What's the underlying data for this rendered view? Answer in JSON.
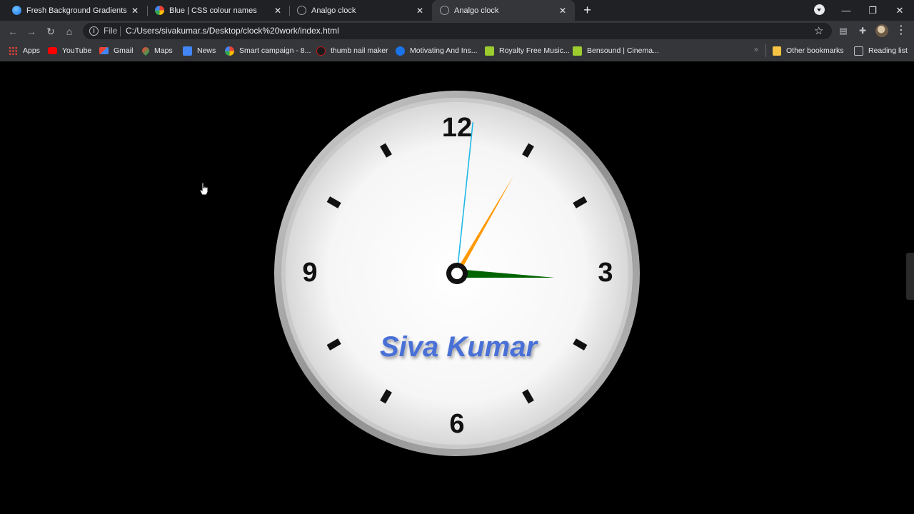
{
  "browser": {
    "tabs": [
      {
        "title": "Fresh Background Gradients | We",
        "active": false
      },
      {
        "title": "Blue | CSS colour names",
        "active": false
      },
      {
        "title": "Analgo clock",
        "active": false
      },
      {
        "title": "Analgo clock",
        "active": true
      }
    ],
    "tab_close_glyph": "✕",
    "new_tab_glyph": "+",
    "window_controls": {
      "minimize": "—",
      "restore": "❐",
      "close": "✕"
    },
    "address_bar": {
      "scheme_label": "File",
      "url": "C:/Users/sivakumar.s/Desktop/clock%20work/index.html"
    },
    "bookmarks": [
      {
        "label": "Apps",
        "icon": "apps-grid-icon",
        "color": "#e8453c"
      },
      {
        "label": "YouTube",
        "icon": "youtube-icon",
        "color": "#ff0000"
      },
      {
        "label": "Gmail",
        "icon": "gmail-icon",
        "color": "#ea4335"
      },
      {
        "label": "Maps",
        "icon": "maps-pin-icon",
        "color": "#34a853"
      },
      {
        "label": "News",
        "icon": "google-news-icon",
        "color": "#4285f4"
      },
      {
        "label": "Smart campaign - 8...",
        "icon": "google-g-icon",
        "color": "#ffffff"
      },
      {
        "label": "thumb nail maker",
        "icon": "thumbnail-maker-icon",
        "color": "#c4161c"
      },
      {
        "label": "Motivating And Ins...",
        "icon": "info-circle-icon",
        "color": "#1a73e8"
      },
      {
        "label": "Royalty Free Music...",
        "icon": "bensound-b-icon",
        "color": "#9ccc2e"
      },
      {
        "label": "Bensound | Cinema...",
        "icon": "bensound-b-icon",
        "color": "#9ccc2e"
      }
    ],
    "other_bookmarks": "Other bookmarks",
    "reading_list": "Reading list",
    "more_glyph": "»"
  },
  "clock": {
    "numerals": {
      "twelve": "12",
      "three": "3",
      "six": "6",
      "nine": "9"
    },
    "label": "Siva Kumar",
    "time": {
      "hour": 3,
      "minute": 5,
      "second": 1
    },
    "colors": {
      "hour_hand": "#006400",
      "minute_hand": "#ff9900",
      "second_hand": "#21b8e6",
      "label": "#4a6fd6",
      "bezel": "#9a9a9a",
      "face": "#f4f4f4"
    }
  }
}
